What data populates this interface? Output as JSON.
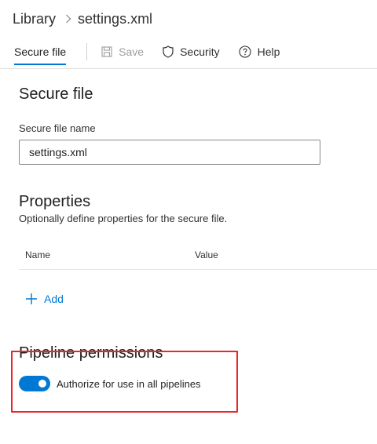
{
  "breadcrumb": {
    "root": "Library",
    "current": "settings.xml"
  },
  "toolbar": {
    "tab_label": "Secure file",
    "save_label": "Save",
    "security_label": "Security",
    "help_label": "Help"
  },
  "secure_file": {
    "title": "Secure file",
    "name_label": "Secure file name",
    "name_value": "settings.xml"
  },
  "properties": {
    "title": "Properties",
    "description": "Optionally define properties for the secure file.",
    "columns": [
      "Name",
      "Value"
    ],
    "add_label": "Add"
  },
  "pipeline_permissions": {
    "title": "Pipeline permissions",
    "toggle_label": "Authorize for use in all pipelines",
    "toggle_on": true
  },
  "colors": {
    "accent": "#0078d4",
    "highlight": "#e8262c"
  },
  "icons": [
    "chevron-right-icon",
    "save-icon",
    "shield-icon",
    "help-icon",
    "plus-icon"
  ]
}
